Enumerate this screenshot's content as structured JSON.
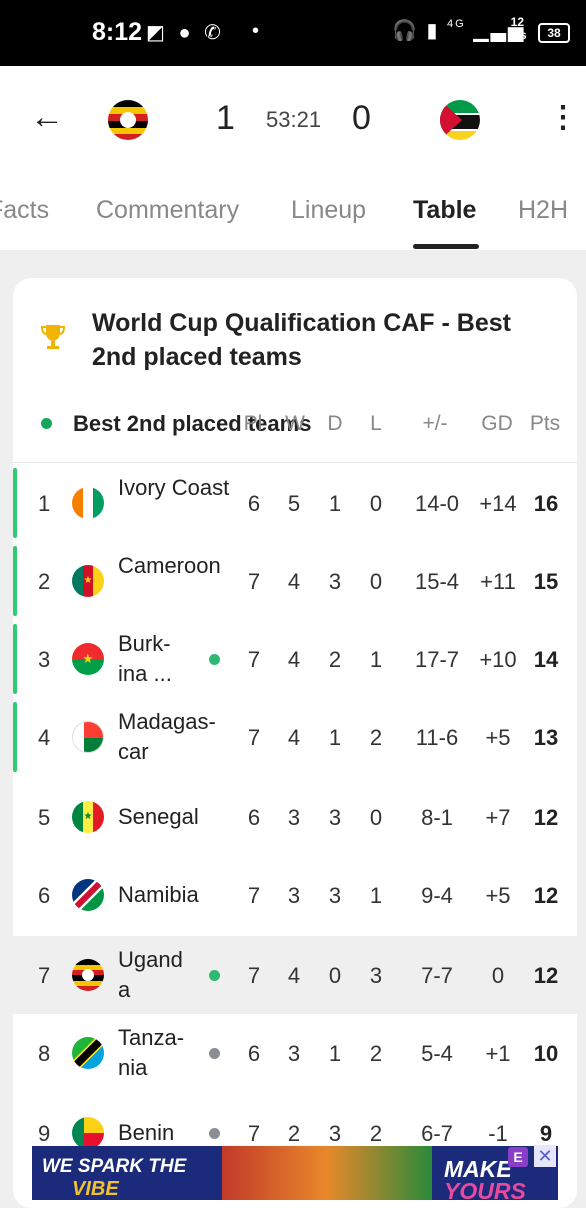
{
  "status_bar": {
    "time": "8:12",
    "network": "4G",
    "speed_value": "12",
    "speed_unit": "K/s",
    "battery": "38"
  },
  "match": {
    "home_score": "1",
    "clock": "53:21",
    "away_score": "0",
    "home_flag": "uganda-flag-icon",
    "away_flag": "mozambique-flag-icon"
  },
  "tabs": [
    {
      "label": "Facts",
      "active": false
    },
    {
      "label": "Commentary",
      "active": false
    },
    {
      "label": "Lineup",
      "active": false
    },
    {
      "label": "Table",
      "active": true
    },
    {
      "label": "H2H",
      "active": false
    }
  ],
  "competition": {
    "title": "World Cup Qualification CAF - Best 2nd placed teams",
    "group_name": "Best 2nd placed teams"
  },
  "table_headers": {
    "pl": "Pl",
    "w": "W",
    "d": "D",
    "l": "L",
    "goals": "+/-",
    "gd": "GD",
    "pts": "Pts"
  },
  "rows": [
    {
      "pos": "1",
      "team": "Ivory Coast",
      "pl": "6",
      "w": "5",
      "d": "1",
      "l": "0",
      "goals": "14-0",
      "gd": "+14",
      "pts": "16",
      "qualified": true,
      "playing": false
    },
    {
      "pos": "2",
      "team": "Cameroon",
      "pl": "7",
      "w": "4",
      "d": "3",
      "l": "0",
      "goals": "15-4",
      "gd": "+11",
      "pts": "15",
      "qualified": true,
      "playing": false
    },
    {
      "pos": "3",
      "team": "Burkina ...",
      "pl": "7",
      "w": "4",
      "d": "2",
      "l": "1",
      "goals": "17-7",
      "gd": "+10",
      "pts": "14",
      "qualified": true,
      "playing": true
    },
    {
      "pos": "4",
      "team": "Madagascar",
      "pl": "7",
      "w": "4",
      "d": "1",
      "l": "2",
      "goals": "11-6",
      "gd": "+5",
      "pts": "13",
      "qualified": true,
      "playing": false
    },
    {
      "pos": "5",
      "team": "Senegal",
      "pl": "6",
      "w": "3",
      "d": "3",
      "l": "0",
      "goals": "8-1",
      "gd": "+7",
      "pts": "12",
      "qualified": false,
      "playing": false
    },
    {
      "pos": "6",
      "team": "Namibia",
      "pl": "7",
      "w": "3",
      "d": "3",
      "l": "1",
      "goals": "9-4",
      "gd": "+5",
      "pts": "12",
      "qualified": false,
      "playing": false
    },
    {
      "pos": "7",
      "team": "Uganda",
      "pl": "7",
      "w": "4",
      "d": "0",
      "l": "3",
      "goals": "7-7",
      "gd": "0",
      "pts": "12",
      "qualified": false,
      "playing": true
    },
    {
      "pos": "8",
      "team": "Tanzania",
      "pl": "6",
      "w": "3",
      "d": "1",
      "l": "2",
      "goals": "5-4",
      "gd": "+1",
      "pts": "10",
      "qualified": false,
      "playing": "grey"
    },
    {
      "pos": "9",
      "team": "Benin",
      "pl": "7",
      "w": "2",
      "d": "3",
      "l": "2",
      "goals": "6-7",
      "gd": "-1",
      "pts": "9",
      "qualified": false,
      "playing": "grey"
    }
  ],
  "ad": {
    "left_line1": "WE SPARK THE",
    "left_line2": "VIBE",
    "right_line1": "MAKE",
    "right_line2": "YOURS"
  },
  "colors": {
    "qualified_bar": "#2ecc71",
    "playing_dot": "#19a55a",
    "inactive_dot": "#8a8f96",
    "highlight_row": "#efefef"
  }
}
